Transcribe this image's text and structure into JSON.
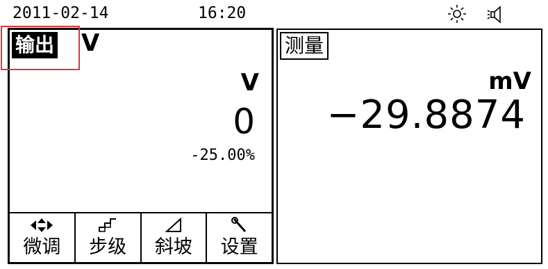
{
  "status": {
    "date": "2011-02-14",
    "time": "16:20",
    "icons": [
      "sun-icon",
      "speaker-icon"
    ]
  },
  "output": {
    "badge": "输出",
    "unit_top": "V",
    "unit_right": "V",
    "value": "0",
    "percent": "-25.00%"
  },
  "functions": [
    {
      "label": "微调",
      "icon": "arrows-icon"
    },
    {
      "label": "步级",
      "icon": "steps-icon"
    },
    {
      "label": "斜坡",
      "icon": "ramp-icon"
    },
    {
      "label": "设置",
      "icon": "wrench-icon"
    }
  ],
  "measure": {
    "badge": "测量",
    "unit": "mV",
    "value": "−29.8874"
  },
  "colors": {
    "highlight": "#d9363e",
    "foreground": "#000000",
    "background": "#ffffff"
  }
}
